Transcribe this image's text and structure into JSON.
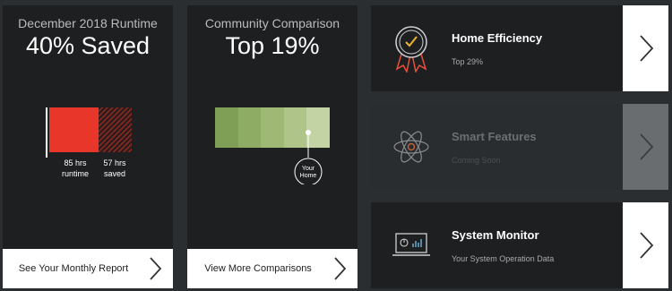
{
  "runtime": {
    "subtitle": "December 2018 Runtime",
    "headline": "40% Saved",
    "runtime_hours": 85,
    "saved_hours": 57,
    "runtime_value": "85 hrs",
    "runtime_label": "runtime",
    "saved_value": "57 hrs",
    "saved_label": "saved",
    "footer_label": "See Your Monthly Report",
    "colors": {
      "runtime": "#e8372a",
      "saved_stripe": "#8a2a24"
    }
  },
  "comparison": {
    "subtitle": "Community Comparison",
    "headline": "Top 19%",
    "marker_label_line1": "Your",
    "marker_label_line2": "Home",
    "marker_position": 0.81,
    "segments": [
      "#7f9f56",
      "#8fac65",
      "#9fb876",
      "#afc489",
      "#c4d3a3"
    ],
    "footer_label": "View More Comparisons"
  },
  "list": [
    {
      "id": "efficiency",
      "title": "Home Efficiency",
      "subtitle": "Top 29%",
      "icon": "award-ribbon-icon",
      "enabled": true
    },
    {
      "id": "smart",
      "title": "Smart Features",
      "subtitle": "Coming Soon",
      "icon": "atom-icon",
      "enabled": false
    },
    {
      "id": "monitor",
      "title": "System Monitor",
      "subtitle": "Your System Operation Data",
      "icon": "laptop-monitor-icon",
      "enabled": true
    }
  ],
  "accent": "#e8372a"
}
